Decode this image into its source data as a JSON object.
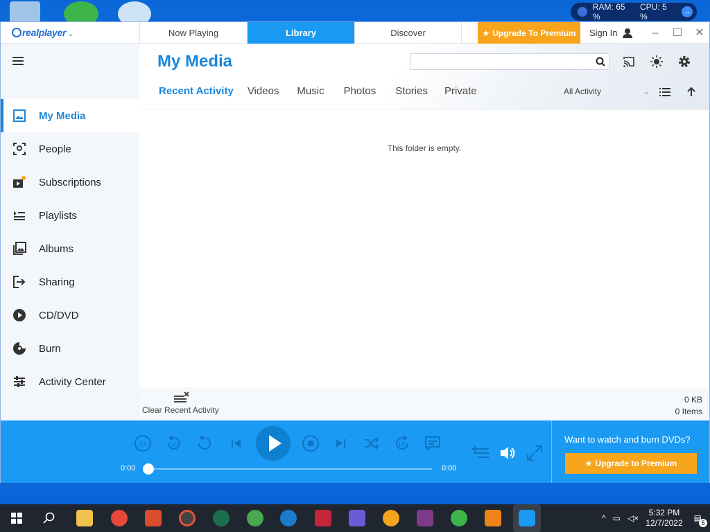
{
  "desktop": {
    "sysmon": {
      "ram": "RAM: 65 %",
      "cpu": "CPU: 5 %"
    }
  },
  "titlebar": {
    "logo": "realplayer",
    "tabs": [
      "Now Playing",
      "Library",
      "Discover"
    ],
    "upgrade_label": "Upgrade To Premium",
    "signin_label": "Sign In"
  },
  "sidebar": {
    "items": [
      {
        "label": "My Media",
        "icon": "image-icon"
      },
      {
        "label": "People",
        "icon": "face-scan-icon"
      },
      {
        "label": "Subscriptions",
        "icon": "subscriptions-icon"
      },
      {
        "label": "Playlists",
        "icon": "playlist-icon"
      },
      {
        "label": "Albums",
        "icon": "album-icon"
      },
      {
        "label": "Sharing",
        "icon": "share-icon"
      },
      {
        "label": "CD/DVD",
        "icon": "disc-play-icon"
      },
      {
        "label": "Burn",
        "icon": "burn-icon"
      },
      {
        "label": "Activity Center",
        "icon": "sliders-icon"
      }
    ]
  },
  "content": {
    "title": "My Media",
    "search_placeholder": "",
    "subtabs": [
      "Recent Activity",
      "Videos",
      "Music",
      "Photos",
      "Stories",
      "Private"
    ],
    "activity_filter": "All Activity",
    "empty_message": "This folder is empty.",
    "clear_label": "Clear Recent Activity",
    "size": "0 KB",
    "items": "0 Items"
  },
  "player": {
    "time_start": "0:00",
    "time_end": "0:00",
    "promo_text": "Want to watch and burn DVDs?",
    "promo_button": "Upgrade to Premium"
  },
  "taskbar": {
    "time": "5:32 PM",
    "date": "12/7/2022",
    "notifications": "5"
  }
}
